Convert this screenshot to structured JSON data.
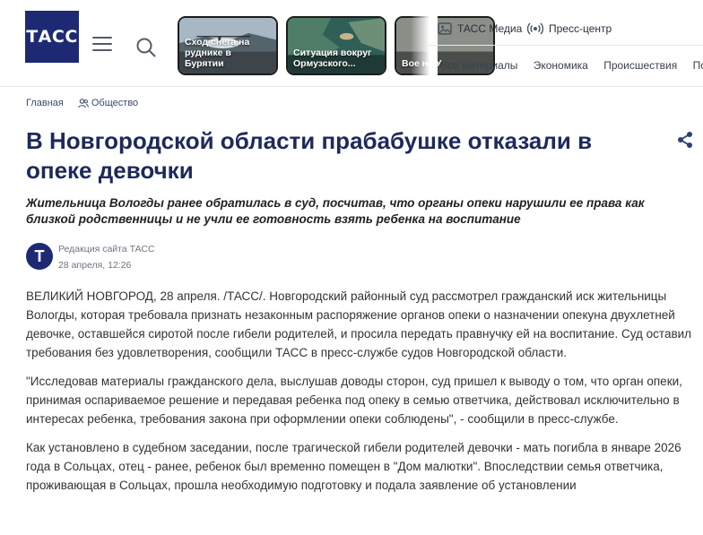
{
  "header": {
    "logo_text": "ТАСС",
    "stories": [
      {
        "caption": "Сход снега на руднике в Бурятии"
      },
      {
        "caption": "Ситуация вокруг Ормузского..."
      },
      {
        "caption": "Вое на У"
      }
    ],
    "links": [
      {
        "label": "ТАСС Медиа",
        "icon": "image-icon"
      },
      {
        "label": "Пресс-центр",
        "icon": "broadcast-icon"
      }
    ],
    "nav": [
      "Все материалы",
      "Экономика",
      "Происшествия",
      "Поли"
    ]
  },
  "breadcrumb": {
    "home": "Главная",
    "section": "Общество"
  },
  "article": {
    "title": "В Новгородской области прабабушке отказали в опеке девочки",
    "lead": "Жительница Вологды ранее обратилась в суд, посчитав, что органы опеки нарушили ее права как близкой родственницы и не учли ее готовность взять ребенка на воспитание",
    "author": {
      "avatar_letter": "Т",
      "name": "Редакция сайта ТАСС",
      "date": "28 апреля, 12:26"
    },
    "paragraphs": [
      "ВЕЛИКИЙ НОВГОРОД, 28 апреля. /ТАСС/. Новгородский районный суд рассмотрел гражданский иск жительницы Вологды, которая требовала признать незаконным распоряжение органов опеки о назначении опекуна двухлетней девочке, оставшейся сиротой после гибели родителей, и просила передать правнучку ей на воспитание. Суд оставил требования без удовлетворения, сообщили ТАСС в пресс-службе судов Новгородской области.",
      "\"Исследовав материалы гражданского дела, выслушав доводы сторон, суд пришел к выводу о том, что орган опеки, принимая оспариваемое решение и передавая ребенка под опеку в семью ответчика, действовал исключительно в интересах ребенка, требования закона при оформлении опеки соблюдены\", - сообщили в пресс-службе.",
      "Как установлено в судебном заседании, после трагической гибели родителей девочки - мать погибла в январе 2026 года в Сольцах, отец - ранее, ребенок был временно помещен в \"Дом малютки\". Впоследствии семья ответчика, проживающая в Сольцах, прошла необходимую подготовку и подала заявление об установлении"
    ]
  },
  "colors": {
    "brand": "#1d2a73",
    "title": "#1d2a5a",
    "link": "#3c4a6b"
  }
}
